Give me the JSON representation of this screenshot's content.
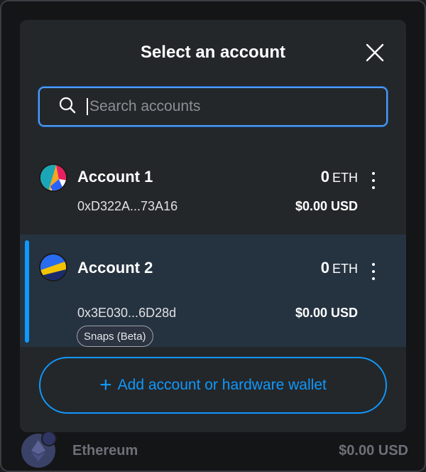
{
  "modal": {
    "title": "Select an account",
    "close_icon": "close-icon"
  },
  "search": {
    "placeholder": "Search accounts",
    "value": ""
  },
  "accounts": [
    {
      "name": "Account 1",
      "address": "0xD322A...73A16",
      "balance": "0",
      "unit": "ETH",
      "fiat": "$0.00 USD",
      "selected": false,
      "avatar_icon": "jazzicon-avatar"
    },
    {
      "name": "Account 2",
      "address": "0x3E030...6D28d",
      "balance": "0",
      "unit": "ETH",
      "fiat": "$0.00 USD",
      "selected": true,
      "badge": "Snaps (Beta)",
      "avatar_icon": "jazzicon-avatar"
    }
  ],
  "add_button": {
    "label": "Add account or hardware wallet",
    "icon": "plus-icon"
  },
  "backdrop": {
    "token_name": "Ethereum",
    "token_value": "$0.00 USD",
    "token_icon": "ethereum-icon"
  },
  "colors": {
    "accent": "#1098fc",
    "modal_bg": "#24272a",
    "selected_row_bg": "#253341"
  }
}
